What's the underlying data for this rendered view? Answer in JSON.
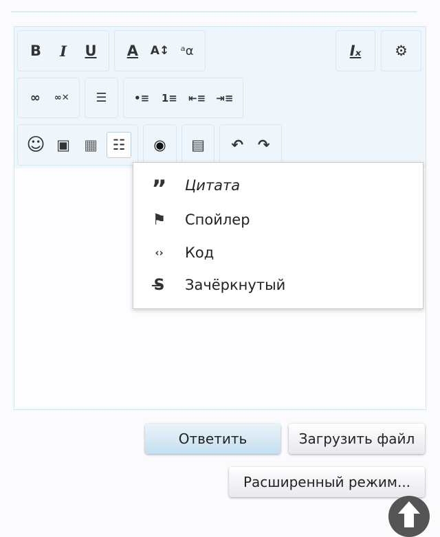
{
  "toolbar": {
    "row1": [
      {
        "icon": "bold-icon",
        "glyph": "B"
      },
      {
        "icon": "italic-icon",
        "glyph": "I"
      },
      {
        "icon": "underline-icon",
        "glyph": "U"
      },
      {
        "icon": "text-color-icon",
        "glyph": "A"
      },
      {
        "icon": "font-size-icon",
        "glyph": "A↕"
      },
      {
        "icon": "font-family-icon",
        "glyph": "ᵃα"
      },
      {
        "icon": "remove-format-icon",
        "glyph": "Iₓ"
      },
      {
        "icon": "bbcode-toggle-icon",
        "glyph": "⚙"
      }
    ],
    "row2": [
      {
        "icon": "link-icon",
        "glyph": "∞"
      },
      {
        "icon": "unlink-icon",
        "glyph": "∞✕"
      },
      {
        "icon": "align-icon",
        "glyph": "☰"
      },
      {
        "icon": "bullet-list-icon",
        "glyph": "•≡"
      },
      {
        "icon": "numbered-list-icon",
        "glyph": "1≡"
      },
      {
        "icon": "outdent-icon",
        "glyph": "⇤≡"
      },
      {
        "icon": "indent-icon",
        "glyph": "⇥≡"
      }
    ],
    "row3": [
      {
        "icon": "smiley-icon",
        "glyph": "☺"
      },
      {
        "icon": "image-icon",
        "glyph": "▣"
      },
      {
        "icon": "media-icon",
        "glyph": "▦"
      },
      {
        "icon": "insert-block-icon",
        "glyph": "☷"
      },
      {
        "icon": "camera-icon",
        "glyph": "◉"
      },
      {
        "icon": "save-draft-icon",
        "glyph": "▤"
      },
      {
        "icon": "undo-icon",
        "glyph": "↶"
      },
      {
        "icon": "redo-icon",
        "glyph": "↷"
      }
    ]
  },
  "dropdown": {
    "items": [
      {
        "icon": "quote-icon",
        "glyph": "”",
        "label": "Цитата"
      },
      {
        "icon": "flag-icon",
        "glyph": "⚑",
        "label": "Спойлер"
      },
      {
        "icon": "code-file-icon",
        "glyph": "‹›",
        "label": "Код"
      },
      {
        "icon": "strikethrough-icon",
        "glyph": "S̶",
        "label": "Зачёркнутый"
      }
    ]
  },
  "buttons": {
    "reply": "Ответить",
    "upload": "Загрузить файл",
    "advanced": "Расширенный режим..."
  },
  "colors": {
    "toolbar_bg": "#eef6fc",
    "reply_button": "#c4dff0"
  }
}
